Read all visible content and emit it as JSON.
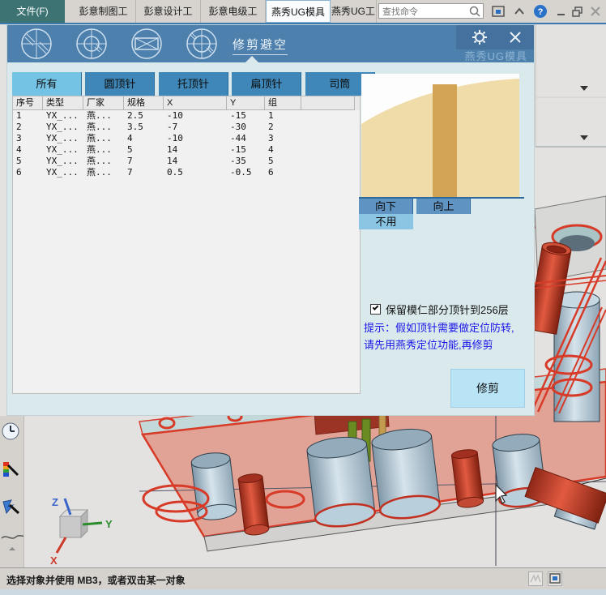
{
  "titlebar": {
    "file_tab": "文件(F)",
    "tabs": [
      {
        "label": "彭意制图工"
      },
      {
        "label": "彭意设计工"
      },
      {
        "label": "彭意电级工"
      },
      {
        "label": "燕秀UG模具"
      },
      {
        "label": "燕秀UG工具"
      }
    ],
    "search_placeholder": "查找命令",
    "help_glyph": "?"
  },
  "dialog": {
    "title": "修剪避空",
    "watermark": "燕秀UG模具",
    "tabs": [
      {
        "label": "所有"
      },
      {
        "label": "圆顶针"
      },
      {
        "label": "托顶针"
      },
      {
        "label": "扁顶针"
      },
      {
        "label": "司筒"
      }
    ],
    "table": {
      "headers": [
        "序号",
        "类型",
        "厂家",
        "规格",
        "X",
        "Y",
        "组",
        ""
      ],
      "rows": [
        [
          "1",
          "YX_...",
          "燕...",
          "2.5",
          "-10",
          "-15",
          "1"
        ],
        [
          "2",
          "YX_...",
          "燕...",
          "3.5",
          "-7",
          "-30",
          "2"
        ],
        [
          "3",
          "YX_...",
          "燕...",
          "4",
          "-10",
          "-44",
          "3"
        ],
        [
          "4",
          "YX_...",
          "燕...",
          "5",
          "14",
          "-15",
          "4"
        ],
        [
          "5",
          "YX_...",
          "燕...",
          "7",
          "14",
          "-35",
          "5"
        ],
        [
          "6",
          "YX_...",
          "燕...",
          "7",
          "0.5",
          "-0.5",
          "6"
        ]
      ]
    },
    "direction_buttons": [
      {
        "label": "向下"
      },
      {
        "label": "向上"
      },
      {
        "label": "不用"
      }
    ],
    "checkbox_label": "保留模仁部分顶针到256层",
    "checkbox_checked": true,
    "hint_line1": "提示：假如顶针需要做定位防转,",
    "hint_line2": "请先用燕秀定位功能,再修剪",
    "trim_button": "修剪"
  },
  "statusbar": {
    "message": "选择对象并使用 MB3，或者双击某一对象"
  },
  "triad": {
    "x_label": "X",
    "y_label": "Y",
    "z_label": "Z"
  },
  "colors": {
    "dialog_header_blue": "#4e80ae",
    "tab_active_blue": "#74c2e4",
    "tab_inactive_blue": "#3e87b8",
    "selection_red": "#d83a28",
    "preview_tan": "#f0dca8",
    "preview_pin_bar": "#d2a355",
    "hint_blue": "#1b16e8",
    "file_tab_teal": "#3d7373"
  }
}
